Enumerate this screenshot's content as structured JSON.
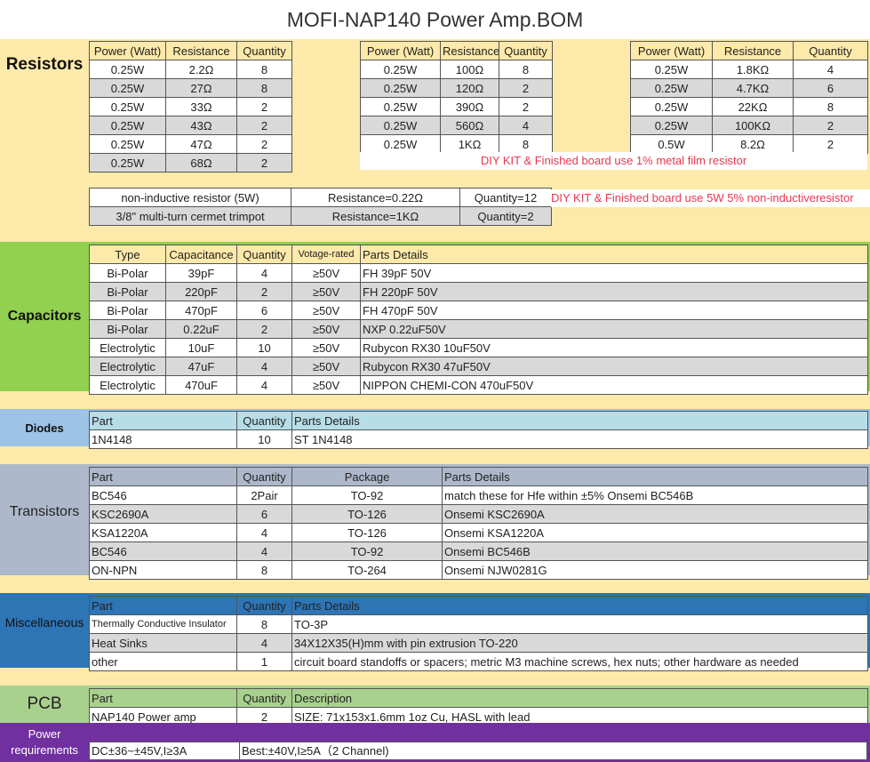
{
  "title": "MOFI-NAP140 Power Amp.BOM",
  "colors": {
    "cream": "#fde9a9",
    "green": "#92d050",
    "blue": "#9dc3e6",
    "steel": "#adb9ca",
    "navy": "#2e75b6",
    "pcb_green": "#a9d18e",
    "purple": "#7030a0",
    "grey_row": "#d9d9d9",
    "red_text": "#e8384f"
  },
  "resistors": {
    "label": "Resistors",
    "headers": [
      "Power (Watt)",
      "Resistance",
      "Quantity"
    ],
    "table1": [
      [
        "0.25W",
        "2.2Ω",
        "8"
      ],
      [
        "0.25W",
        "27Ω",
        "8"
      ],
      [
        "0.25W",
        "33Ω",
        "2"
      ],
      [
        "0.25W",
        "43Ω",
        "2"
      ],
      [
        "0.25W",
        "47Ω",
        "2"
      ],
      [
        "0.25W",
        "68Ω",
        "2"
      ]
    ],
    "table2": [
      [
        "0.25W",
        "100Ω",
        "8"
      ],
      [
        "0.25W",
        "120Ω",
        "2"
      ],
      [
        "0.25W",
        "390Ω",
        "2"
      ],
      [
        "0.25W",
        "560Ω",
        "4"
      ],
      [
        "0.25W",
        "1KΩ",
        "8"
      ]
    ],
    "table3": [
      [
        "0.25W",
        "1.8KΩ",
        "4"
      ],
      [
        "0.25W",
        "4.7KΩ",
        "6"
      ],
      [
        "0.25W",
        "22KΩ",
        "8"
      ],
      [
        "0.25W",
        "100KΩ",
        "2"
      ],
      [
        "0.5W",
        "8.2Ω",
        "2"
      ]
    ],
    "note1": "DIY KIT & Finished board use 1% metal film resistor",
    "special": [
      [
        "non-inductive resistor (5W)",
        "Resistance=0.22Ω",
        "Quantity=12"
      ],
      [
        "3/8\" multi-turn cermet trimpot",
        "Resistance=1KΩ",
        "Quantity=2"
      ]
    ],
    "note2": "DIY KIT & Finished board use 5W 5% non-inductiveresistor"
  },
  "capacitors": {
    "label": "Capacitors",
    "headers": [
      "Type",
      "Capacitance",
      "Quantity",
      "Votage-rated",
      "Parts Details"
    ],
    "rows": [
      [
        "Bi-Polar",
        "39pF",
        "4",
        "≥50V",
        "FH   39pF 50V"
      ],
      [
        "Bi-Polar",
        "220pF",
        "2",
        "≥50V",
        "FH 220pF 50V"
      ],
      [
        "Bi-Polar",
        "470pF",
        "6",
        "≥50V",
        "FH 470pF 50V"
      ],
      [
        "Bi-Polar",
        "0.22uF",
        "2",
        "≥50V",
        "NXP 0.22uF50V"
      ],
      [
        "Electrolytic",
        "10uF",
        "10",
        "≥50V",
        "Rubycon RX30 10uF50V"
      ],
      [
        "Electrolytic",
        "47uF",
        "4",
        "≥50V",
        "Rubycon RX30 47uF50V"
      ],
      [
        "Electrolytic",
        "470uF",
        "4",
        "≥50V",
        "NIPPON CHEMI-CON 470uF50V"
      ]
    ]
  },
  "diodes": {
    "label": "Diodes",
    "headers": [
      "Part",
      "Quantity",
      "Parts Details"
    ],
    "rows": [
      [
        "1N4148",
        "10",
        "ST 1N4148"
      ]
    ]
  },
  "transistors": {
    "label": "Transistors",
    "headers": [
      "Part",
      "Quantity",
      "Package",
      "Parts Details"
    ],
    "rows": [
      [
        "BC546",
        "2Pair",
        "TO-92",
        "match these for Hfe within ±5%  Onsemi BC546B"
      ],
      [
        "KSC2690A",
        "6",
        "TO-126",
        "Onsemi KSC2690A"
      ],
      [
        "KSA1220A",
        "4",
        "TO-126",
        "Onsemi KSA1220A"
      ],
      [
        "BC546",
        "4",
        "TO-92",
        "Onsemi BC546B"
      ],
      [
        "ON-NPN",
        "8",
        "TO-264",
        "Onsemi NJW0281G"
      ]
    ]
  },
  "misc": {
    "label": "Miscellaneous",
    "headers": [
      "Part",
      "Quantity",
      "Parts Details"
    ],
    "rows": [
      [
        "Thermally Conductive Insulator",
        "8",
        "TO-3P"
      ],
      [
        "Heat Sinks",
        "4",
        "34X12X35(H)mm with pin extrusion TO-220"
      ],
      [
        "other",
        "1",
        "circuit board standoffs or spacers;  metric M3 machine screws, hex nuts;  other hardware as needed"
      ]
    ]
  },
  "pcb": {
    "label": "PCB",
    "headers": [
      "Part",
      "Quantity",
      "Description"
    ],
    "rows": [
      [
        "NAP140 Power amp",
        "2",
        "SIZE: 71x153x1.6mm    1oz Cu, HASL with lead"
      ]
    ]
  },
  "power": {
    "label": "Power requirements",
    "min": "DC±36~±45V,I≥3A",
    "best": "Best:±40V,I≥5A（2 Channel)"
  }
}
